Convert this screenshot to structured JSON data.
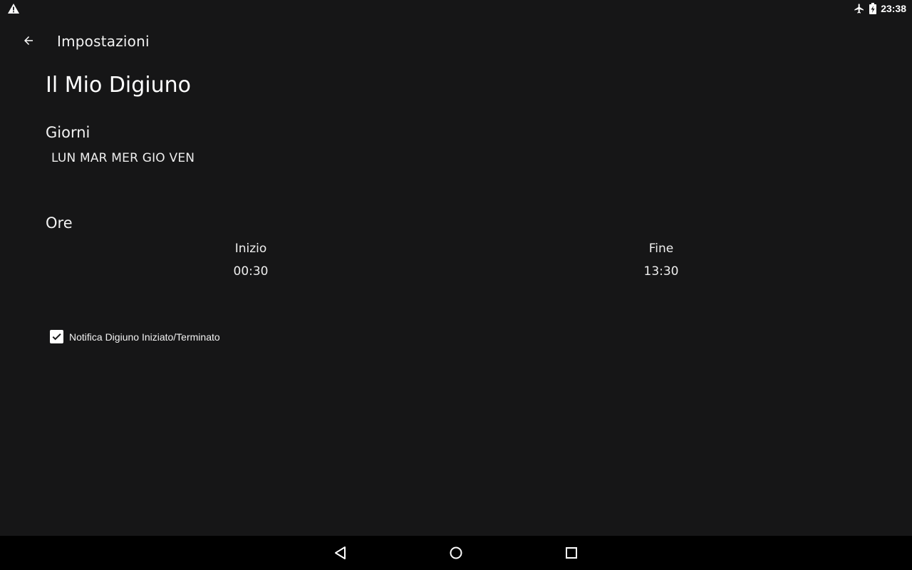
{
  "status_bar": {
    "time": "23:38",
    "icons": [
      "warning-icon",
      "airplane-mode-icon",
      "battery-charging-icon"
    ]
  },
  "app_bar": {
    "title": "Impostazioni",
    "back_icon": "arrow-back-icon"
  },
  "page": {
    "title": "Il Mio Digiuno",
    "days_section": {
      "title": "Giorni",
      "value": "LUN MAR MER GIO VEN"
    },
    "hours_section": {
      "title": "Ore",
      "start_label": "Inizio",
      "start_value": "00:30",
      "end_label": "Fine",
      "end_value": "13:30"
    },
    "notification_checkbox": {
      "label": "Notifica Digiuno Iniziato/Terminato",
      "checked": true
    }
  },
  "nav_bar": {
    "buttons": [
      "back-triangle-icon",
      "home-circle-icon",
      "recents-square-icon"
    ]
  },
  "colors": {
    "background": "#161617",
    "nav_background": "#000000",
    "text": "#ffffff"
  }
}
